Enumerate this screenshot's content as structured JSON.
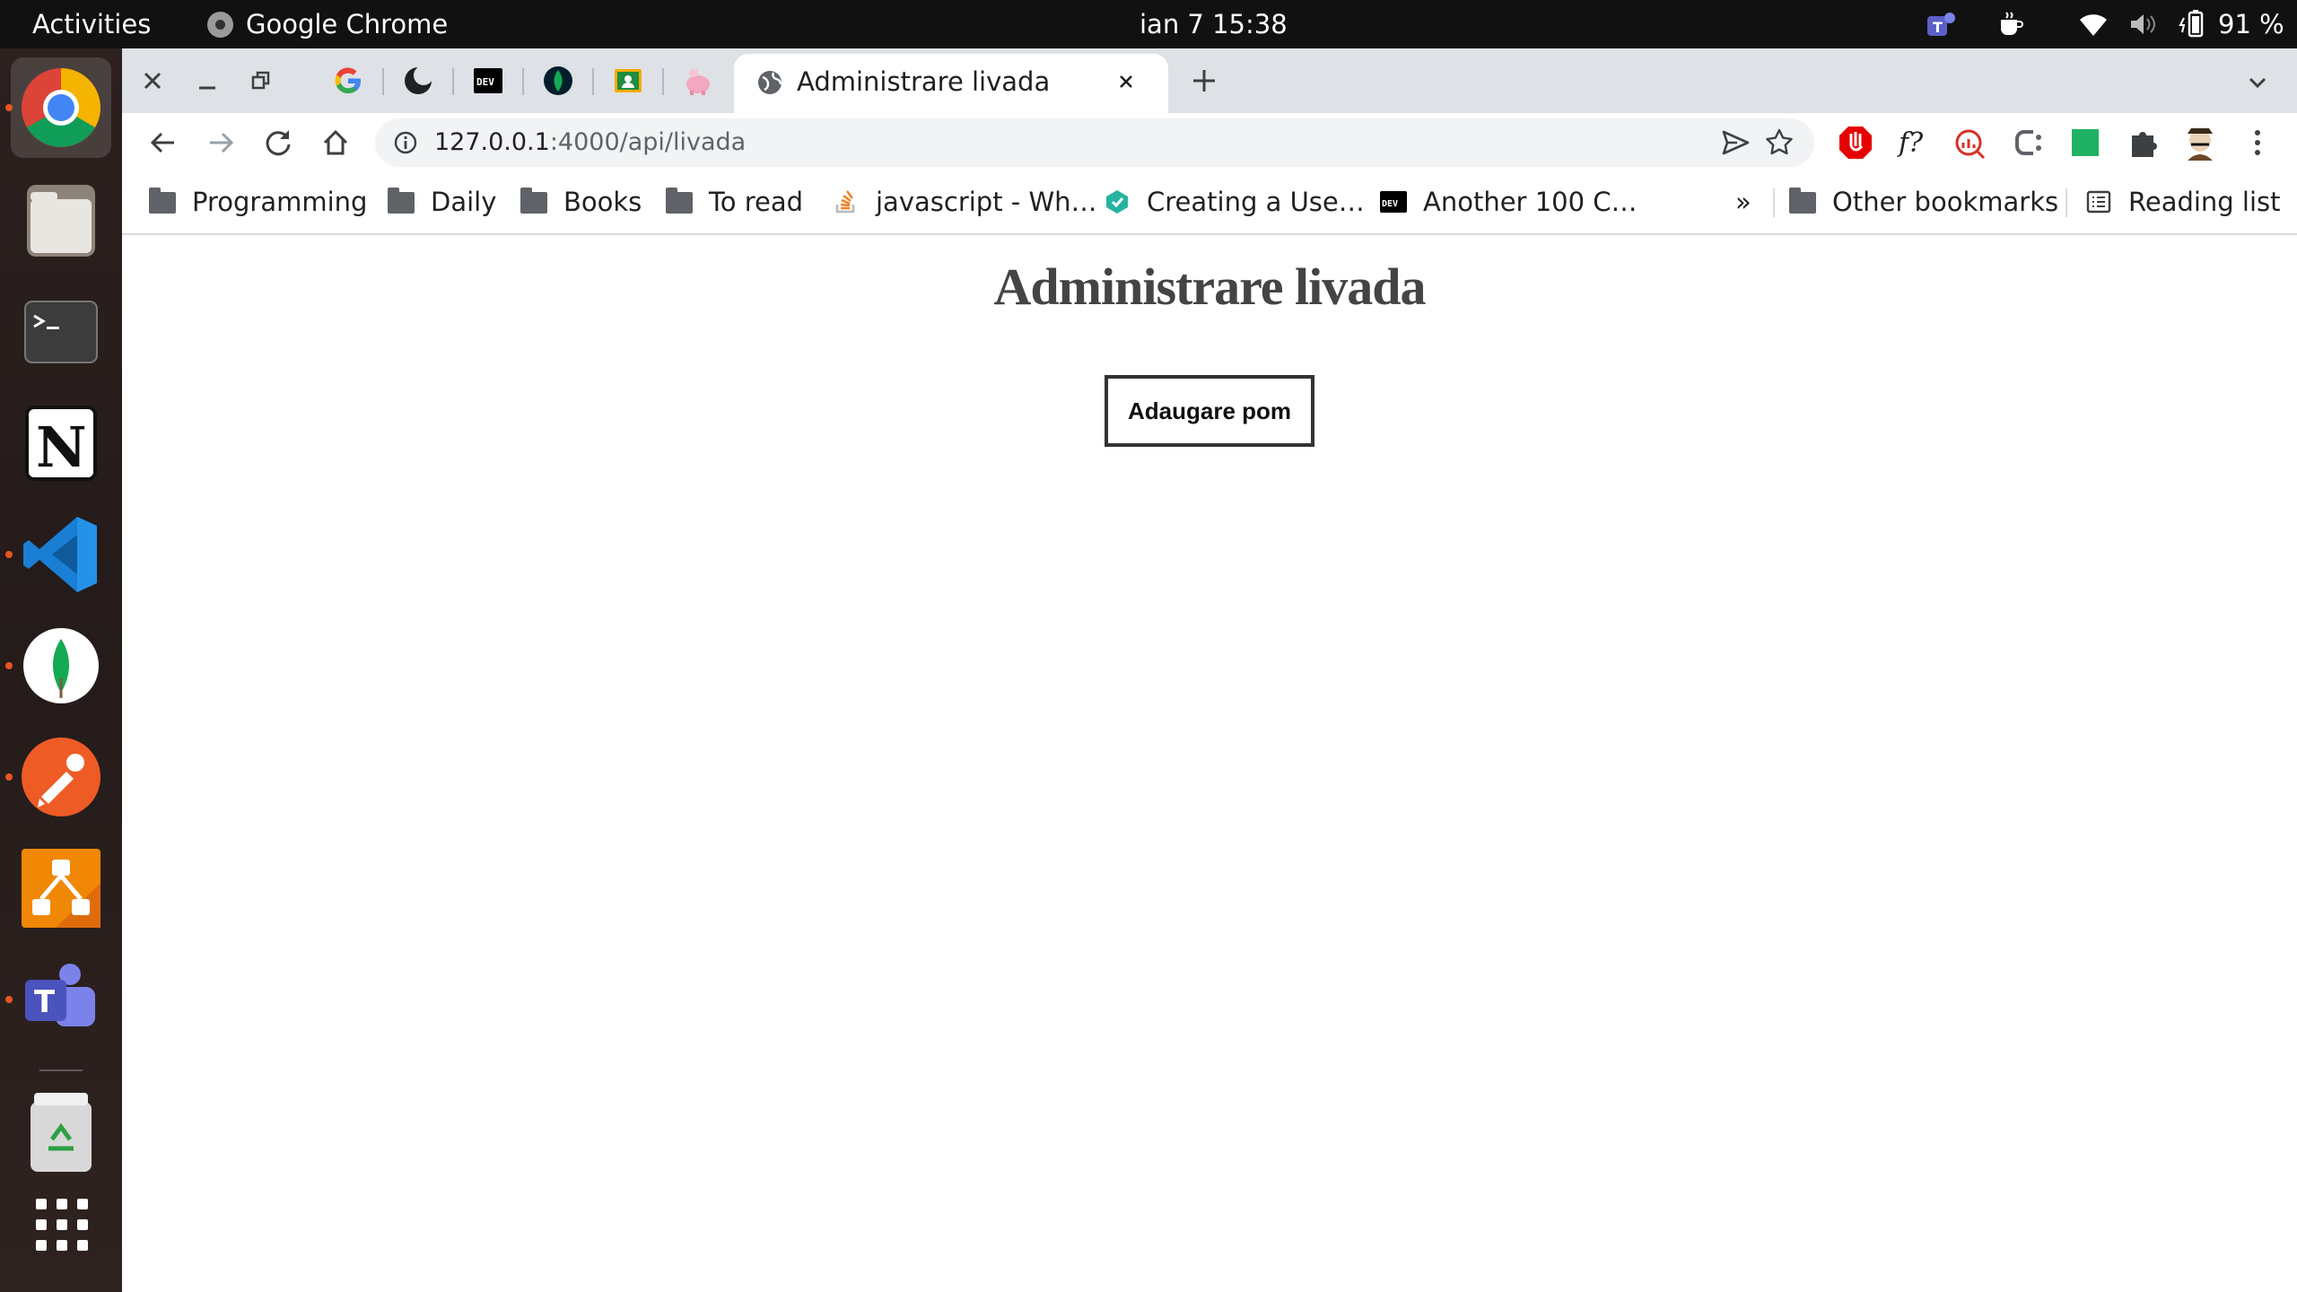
{
  "topbar": {
    "activities": "Activities",
    "app_name": "Google Chrome",
    "clock": "ian 7  15:38",
    "battery": "91 %"
  },
  "dock": {
    "apps": [
      "chrome-icon",
      "files-icon",
      "terminal-icon",
      "notion-icon",
      "vscode-icon",
      "mongodb-compass-icon",
      "postman-icon",
      "drawio-icon",
      "teams-icon",
      "trash-icon",
      "show-apps-icon"
    ]
  },
  "browser": {
    "active_tab_title": "Administrare livada",
    "url_host": "127.0.0.1",
    "url_rest": ":4000/api/livada",
    "bookmarks": [
      "Programming",
      "Daily",
      "Books",
      "To read",
      "javascript - Wh…",
      "Creating a Use…",
      "Another 100 C…"
    ],
    "overflow": "»",
    "other_bookmarks": "Other bookmarks",
    "reading_list": "Reading list",
    "ext_font_label": "f?"
  },
  "page": {
    "heading": "Administrare livada",
    "add_button": "Adaugare pom"
  }
}
